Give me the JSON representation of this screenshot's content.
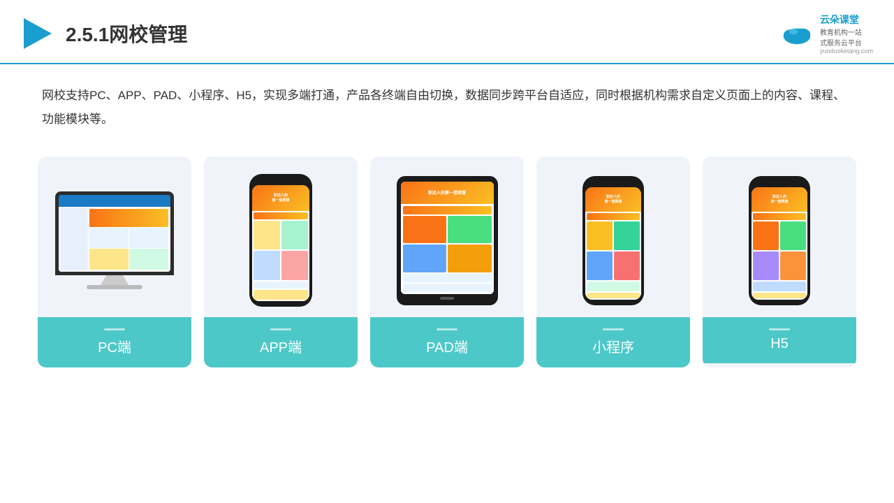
{
  "header": {
    "title": "2.5.1网校管理",
    "logo_name": "yunduoketang-logo",
    "logo_text_line1": "教育机构一站",
    "logo_text_line2": "式服务云平台",
    "logo_url": "yunduoketang.com"
  },
  "description": {
    "text": "网校支持PC、APP、PAD、小程序、H5，实现多端打通，产品各终端自由切换，数据同步跨平台自适应，同时根据机构需求自定义页面上的内容、课程、功能模块等。"
  },
  "cards": [
    {
      "id": "pc",
      "label": "PC端"
    },
    {
      "id": "app",
      "label": "APP端"
    },
    {
      "id": "pad",
      "label": "PAD端"
    },
    {
      "id": "miniapp",
      "label": "小程序"
    },
    {
      "id": "h5",
      "label": "H5"
    }
  ]
}
